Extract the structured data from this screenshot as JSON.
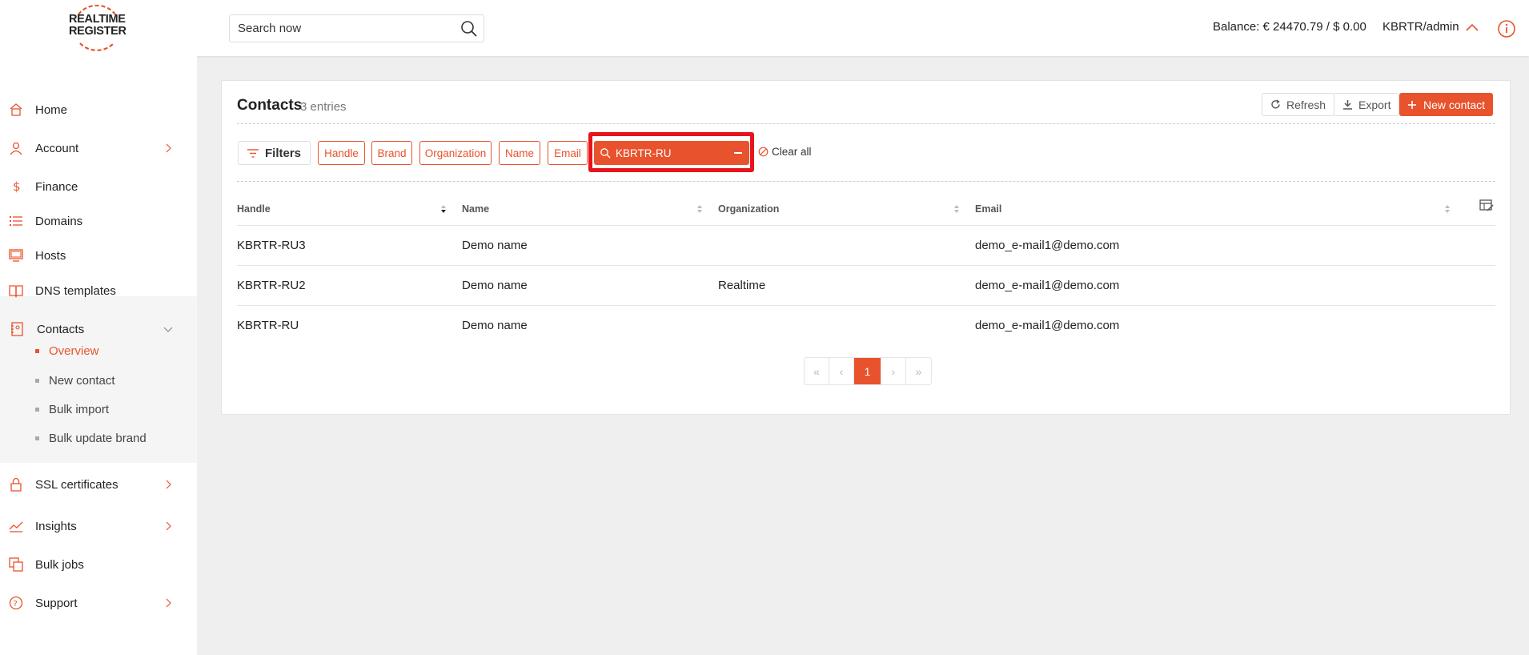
{
  "brand": {
    "logo_line1": "REALTIME",
    "logo_line2": "REGISTER",
    "accent_color": "#e8532d"
  },
  "header": {
    "search_placeholder": "Search now",
    "balance": "Balance: € 24470.79 / $ 0.00",
    "user": "KBRTR/admin"
  },
  "sidebar": {
    "items": [
      {
        "label": "Home",
        "icon": "home-icon"
      },
      {
        "label": "Account",
        "icon": "user-icon"
      },
      {
        "label": "Finance",
        "icon": "dollar-icon"
      },
      {
        "label": "Domains",
        "icon": "list-icon"
      },
      {
        "label": "Hosts",
        "icon": "monitor-icon"
      },
      {
        "label": "DNS templates",
        "icon": "book-icon"
      },
      {
        "label": "Contacts",
        "icon": "contacts-icon"
      },
      {
        "label": "SSL certificates",
        "icon": "lock-icon"
      },
      {
        "label": "Insights",
        "icon": "chart-line-icon"
      },
      {
        "label": "Bulk jobs",
        "icon": "copy-icon"
      },
      {
        "label": "Support",
        "icon": "help-circle-icon"
      }
    ],
    "contacts_sub": [
      {
        "label": "Overview",
        "active": true
      },
      {
        "label": "New contact",
        "active": false
      },
      {
        "label": "Bulk import",
        "active": false
      },
      {
        "label": "Bulk update brand",
        "active": false
      }
    ]
  },
  "contacts": {
    "title": "Contacts",
    "count": "3 entries",
    "refresh_label": "Refresh",
    "export_label": "Export",
    "new_contact_label": "New contact",
    "filters_label": "Filters",
    "filter_chips": [
      "Handle",
      "Brand",
      "Organization",
      "Name",
      "Email"
    ],
    "active_filter": "KBRTR-RU",
    "clear_all": "Clear all",
    "columns": [
      "Handle",
      "Name",
      "Organization",
      "Email"
    ],
    "rows": [
      {
        "handle": "KBRTR-RU3",
        "name": "Demo name",
        "organization": "",
        "email": "demo_e-mail1@demo.com"
      },
      {
        "handle": "KBRTR-RU2",
        "name": "Demo name",
        "organization": "Realtime",
        "email": "demo_e-mail1@demo.com"
      },
      {
        "handle": "KBRTR-RU",
        "name": "Demo name",
        "organization": "",
        "email": "demo_e-mail1@demo.com"
      }
    ],
    "pagination": {
      "first": "«",
      "prev": "‹",
      "current": "1",
      "next": "›",
      "last": "»"
    }
  }
}
